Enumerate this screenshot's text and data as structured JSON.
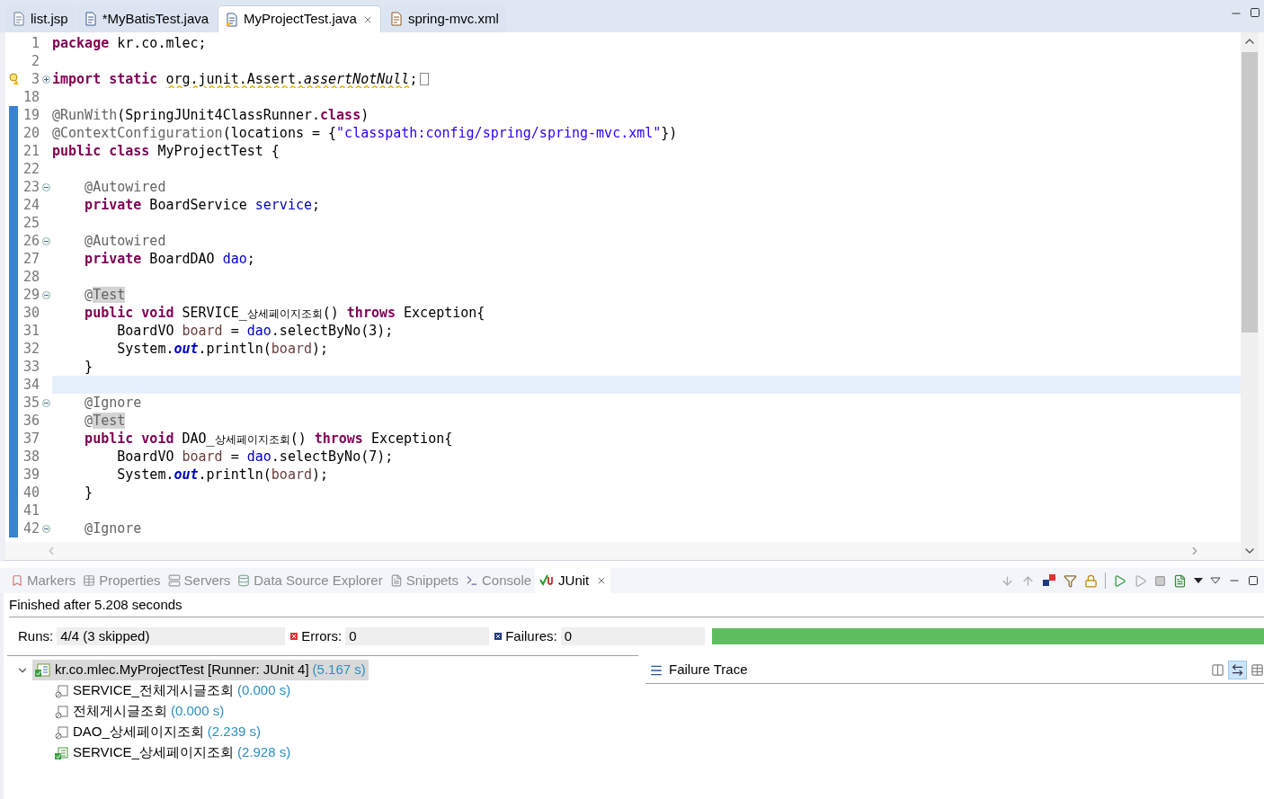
{
  "editor_tabs": [
    {
      "label": "list.jsp",
      "kind": "jsp",
      "selected": false,
      "closable": false
    },
    {
      "label": "*MyBatisTest.java",
      "kind": "java",
      "selected": false,
      "closable": false
    },
    {
      "label": "MyProjectTest.java",
      "kind": "java-warning",
      "selected": true,
      "closable": true
    },
    {
      "label": "spring-mvc.xml",
      "kind": "xml",
      "selected": false,
      "closable": false
    }
  ],
  "code_lines": [
    {
      "number": "1",
      "changed": false,
      "current": false,
      "tokens": [
        {
          "kind": "keyword",
          "text": "package"
        },
        {
          "kind": "plain",
          "text": " kr.co.mlec;"
        }
      ]
    },
    {
      "number": "2",
      "changed": false,
      "current": false
    },
    {
      "number": "3",
      "changed": false,
      "current": false,
      "warning": true,
      "folded": true,
      "tokens": [
        {
          "kind": "keyword",
          "text": "import static "
        },
        {
          "kind": "warn",
          "text": "org.junit.Assert."
        },
        {
          "kind": "warn-italic",
          "text": "assertNotNull"
        },
        {
          "kind": "plain",
          "text": ";"
        }
      ]
    },
    {
      "number": "18",
      "changed": false,
      "current": false
    },
    {
      "number": "19",
      "changed": true,
      "current": false,
      "tokens": [
        {
          "kind": "annotation",
          "text": "@RunWith"
        },
        {
          "kind": "plain",
          "text": "(SpringJUnit4ClassRunner."
        },
        {
          "kind": "keyword",
          "text": "class"
        },
        {
          "kind": "plain",
          "text": ")"
        }
      ]
    },
    {
      "number": "20",
      "changed": true,
      "current": false,
      "tokens": [
        {
          "kind": "annotation",
          "text": "@ContextConfiguration"
        },
        {
          "kind": "plain",
          "text": "(locations = {"
        },
        {
          "kind": "string",
          "text": "\"classpath:config/spring/spring-mvc.xml\""
        },
        {
          "kind": "plain",
          "text": "})"
        }
      ]
    },
    {
      "number": "21",
      "changed": true,
      "current": false,
      "tokens": [
        {
          "kind": "keyword",
          "text": "public class"
        },
        {
          "kind": "plain",
          "text": " MyProjectTest {"
        }
      ]
    },
    {
      "number": "22",
      "changed": true,
      "current": false
    },
    {
      "number": "23",
      "changed": true,
      "current": false,
      "folded": false,
      "tokens": [
        {
          "kind": "annotation",
          "text": "    @Autowired"
        }
      ]
    },
    {
      "number": "24",
      "changed": true,
      "current": false,
      "tokens": [
        {
          "kind": "keyword",
          "text": "    private"
        },
        {
          "kind": "plain",
          "text": " BoardService "
        },
        {
          "kind": "field",
          "text": "service"
        },
        {
          "kind": "plain",
          "text": ";"
        }
      ]
    },
    {
      "number": "25",
      "changed": true,
      "current": false
    },
    {
      "number": "26",
      "changed": true,
      "current": false,
      "folded": false,
      "tokens": [
        {
          "kind": "annotation",
          "text": "    @Autowired"
        }
      ]
    },
    {
      "number": "27",
      "changed": true,
      "current": false,
      "tokens": [
        {
          "kind": "keyword",
          "text": "    private"
        },
        {
          "kind": "plain",
          "text": " BoardDAO "
        },
        {
          "kind": "field",
          "text": "dao"
        },
        {
          "kind": "plain",
          "text": ";"
        }
      ]
    },
    {
      "number": "28",
      "changed": true,
      "current": false
    },
    {
      "number": "29",
      "changed": true,
      "current": false,
      "folded": false,
      "tokens": [
        {
          "kind": "annotation",
          "text": "    @"
        },
        {
          "kind": "annotation-marked",
          "text": "Test"
        }
      ]
    },
    {
      "number": "30",
      "changed": true,
      "current": false,
      "tokens": [
        {
          "kind": "keyword",
          "text": "    public void"
        },
        {
          "kind": "plain",
          "text": " SERVICE_"
        },
        {
          "kind": "hangul",
          "text": "상세페이지조회"
        },
        {
          "kind": "plain",
          "text": "() "
        },
        {
          "kind": "keyword",
          "text": "throws"
        },
        {
          "kind": "plain",
          "text": " Exception{"
        }
      ]
    },
    {
      "number": "31",
      "changed": true,
      "current": false,
      "tokens": [
        {
          "kind": "plain",
          "text": "        BoardVO "
        },
        {
          "kind": "local",
          "text": "board"
        },
        {
          "kind": "plain",
          "text": " = "
        },
        {
          "kind": "field",
          "text": "dao"
        },
        {
          "kind": "plain",
          "text": ".selectByNo(3);"
        }
      ]
    },
    {
      "number": "32",
      "changed": true,
      "current": false,
      "tokens": [
        {
          "kind": "plain",
          "text": "        System."
        },
        {
          "kind": "static-field",
          "text": "out"
        },
        {
          "kind": "plain",
          "text": ".println("
        },
        {
          "kind": "local",
          "text": "board"
        },
        {
          "kind": "plain",
          "text": ");"
        }
      ]
    },
    {
      "number": "33",
      "changed": true,
      "current": false,
      "tokens": [
        {
          "kind": "plain",
          "text": "    }"
        }
      ]
    },
    {
      "number": "34",
      "changed": true,
      "current": true
    },
    {
      "number": "35",
      "changed": true,
      "current": false,
      "folded": false,
      "tokens": [
        {
          "kind": "annotation",
          "text": "    @Ignore"
        }
      ]
    },
    {
      "number": "36",
      "changed": true,
      "current": false,
      "tokens": [
        {
          "kind": "annotation",
          "text": "    @"
        },
        {
          "kind": "annotation-marked",
          "text": "Test"
        }
      ]
    },
    {
      "number": "37",
      "changed": true,
      "current": false,
      "tokens": [
        {
          "kind": "keyword",
          "text": "    public void"
        },
        {
          "kind": "plain",
          "text": " DAO_"
        },
        {
          "kind": "hangul",
          "text": "상세페이지조회"
        },
        {
          "kind": "plain",
          "text": "() "
        },
        {
          "kind": "keyword",
          "text": "throws"
        },
        {
          "kind": "plain",
          "text": " Exception{"
        }
      ]
    },
    {
      "number": "38",
      "changed": true,
      "current": false,
      "tokens": [
        {
          "kind": "plain",
          "text": "        BoardVO "
        },
        {
          "kind": "local",
          "text": "board"
        },
        {
          "kind": "plain",
          "text": " = "
        },
        {
          "kind": "field",
          "text": "dao"
        },
        {
          "kind": "plain",
          "text": ".selectByNo(7);"
        }
      ]
    },
    {
      "number": "39",
      "changed": true,
      "current": false,
      "tokens": [
        {
          "kind": "plain",
          "text": "        System."
        },
        {
          "kind": "static-field",
          "text": "out"
        },
        {
          "kind": "plain",
          "text": ".println("
        },
        {
          "kind": "local",
          "text": "board"
        },
        {
          "kind": "plain",
          "text": ");"
        }
      ]
    },
    {
      "number": "40",
      "changed": true,
      "current": false,
      "tokens": [
        {
          "kind": "plain",
          "text": "    }"
        }
      ]
    },
    {
      "number": "41",
      "changed": true,
      "current": false
    },
    {
      "number": "42",
      "changed": true,
      "current": false,
      "folded": false,
      "tokens": [
        {
          "kind": "annotation",
          "text": "    @Ignore"
        }
      ]
    }
  ],
  "view_tabs": [
    {
      "label": "Markers",
      "kind": "markers",
      "selected": false
    },
    {
      "label": "Properties",
      "kind": "properties",
      "selected": false
    },
    {
      "label": "Servers",
      "kind": "servers",
      "selected": false
    },
    {
      "label": "Data Source Explorer",
      "kind": "datasource",
      "selected": false
    },
    {
      "label": "Snippets",
      "kind": "snippets",
      "selected": false
    },
    {
      "label": "Console",
      "kind": "console",
      "selected": false
    },
    {
      "label": "JUnit",
      "kind": "junit",
      "selected": true
    }
  ],
  "junit": {
    "status": "Finished after 5.208 seconds",
    "counters": [
      {
        "kind": "runs",
        "label": "Runs:",
        "value": "4/4 (3 skipped)"
      },
      {
        "kind": "errors",
        "label": "Errors:",
        "value": "0"
      },
      {
        "kind": "failures",
        "label": "Failures:",
        "value": "0"
      }
    ],
    "progress": {
      "level": 1
    },
    "tree": [
      {
        "name": "kr.co.mlec.MyProjectTest [Runner: JUnit 4]",
        "time": "(5.167 s)",
        "expanded": true,
        "selected": true,
        "children": [
          {
            "name": "SERVICE_전체게시글조회",
            "time": "(0.000 s)",
            "kind": "ignored",
            "selected": false
          },
          {
            "name": "전체게시글조회",
            "time": "(0.000 s)",
            "kind": "ignored",
            "selected": false
          },
          {
            "name": "DAO_상세페이지조회",
            "time": "(2.239 s)",
            "kind": "ignored",
            "selected": false
          },
          {
            "name": "SERVICE_상세페이지조회",
            "time": "(2.928 s)",
            "kind": "passed",
            "selected": false
          }
        ]
      }
    ],
    "failure_trace": {
      "title": "Failure Trace"
    }
  }
}
